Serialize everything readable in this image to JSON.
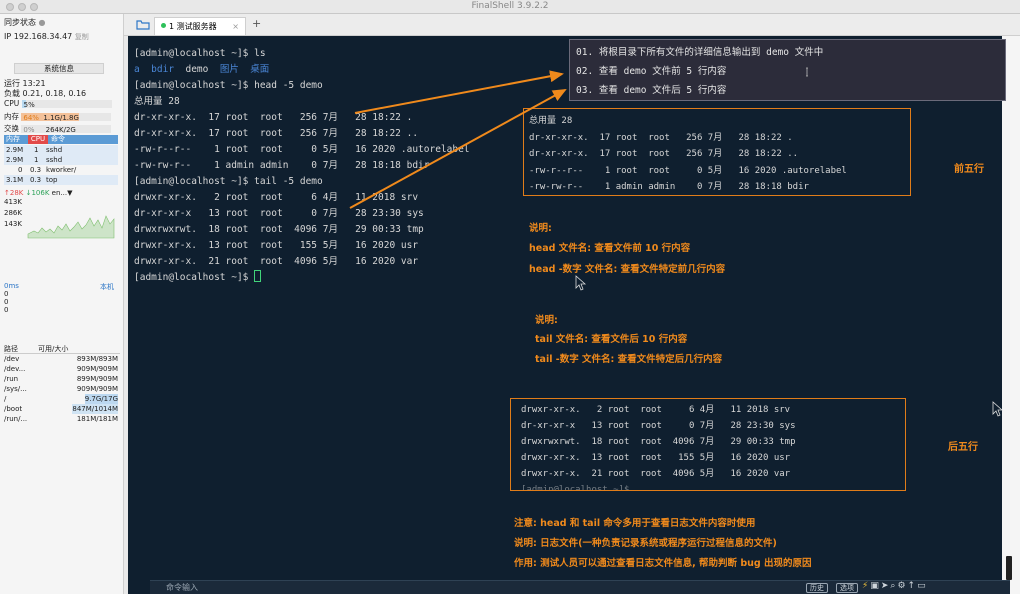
{
  "app": {
    "title": "FinalShell 3.9.2.2"
  },
  "sidebar": {
    "sync_status": "同步状态",
    "ip": "IP 192.168.34.47",
    "copy_label": "复制",
    "sysinfo_button": "系统信息",
    "uptime": "运行 13:21",
    "load": "负载 0.21, 0.18, 0.16",
    "cpu": {
      "label": "CPU",
      "value": "5%",
      "percent": 5
    },
    "mem": {
      "label": "内存",
      "pct": "64%",
      "value": "1.1G/1.8G",
      "percent": 64
    },
    "swap": {
      "label": "交换",
      "pct": "0%",
      "value": "264K/2G",
      "percent": 0
    },
    "proc_headers": [
      "内存",
      "CPU",
      "命令"
    ],
    "processes": [
      {
        "mem": "2.9M",
        "cpu": "1",
        "cmd": "sshd"
      },
      {
        "mem": "2.9M",
        "cpu": "1",
        "cmd": "sshd"
      },
      {
        "mem": "0",
        "cpu": "0.3",
        "cmd": "kworker/"
      },
      {
        "mem": "3.1M",
        "cpu": "0.3",
        "cmd": "top"
      }
    ],
    "net": {
      "up": "↑28K",
      "down": "↓106K",
      "iface": "en...",
      "ticks": [
        "413K",
        "286K",
        "143K"
      ]
    },
    "latency": {
      "value": "0ms",
      "host": "本机",
      "rows": [
        "0",
        "0",
        "0"
      ]
    },
    "disk_headers": [
      "路径",
      "可用/大小"
    ],
    "disks": [
      {
        "path": "/dev",
        "size": "893M/893M"
      },
      {
        "path": "/dev...",
        "size": "909M/909M"
      },
      {
        "path": "/run",
        "size": "899M/909M"
      },
      {
        "path": "/sys/...",
        "size": "909M/909M"
      },
      {
        "path": "/",
        "size": "9.7G/17G"
      },
      {
        "path": "/boot",
        "size": "847M/1014M"
      },
      {
        "path": "/run/...",
        "size": "181M/181M"
      }
    ]
  },
  "tabs": [
    {
      "label": "1 测试服务器"
    }
  ],
  "terminal": {
    "l01": "[admin@localhost ~]$ ls",
    "l02_a": "a  bdir",
    "l02_b": "  demo  ",
    "l02_c": "图片  桌面",
    "l03": "[admin@localhost ~]$ head -5 demo",
    "l04": "总用量 28",
    "l05": "dr-xr-xr-x.  17 root  root   256 7月   28 18:22 .",
    "l06": "dr-xr-xr-x.  17 root  root   256 7月   28 18:22 ..",
    "l07": "-rw-r--r--    1 root  root     0 5月   16 2020 .autorelabel",
    "l08": "-rw-rw-r--    1 admin admin    0 7月   28 18:18 bdir",
    "l09": "[admin@localhost ~]$ tail -5 demo",
    "l10": "drwxr-xr-x.   2 root  root     6 4月   11 2018 srv",
    "l11": "dr-xr-xr-x   13 root  root     0 7月   28 23:30 sys",
    "l12": "drwxrwxrwt.  18 root  root  4096 7月   29 00:33 tmp",
    "l13": "drwxr-xr-x.  13 root  root   155 5月   16 2020 usr",
    "l14": "drwxr-xr-x.  21 root  root  4096 5月   16 2020 var",
    "l15": "[admin@localhost ~]$ "
  },
  "notes": {
    "n1": "01. 将根目录下所有文件的详细信息输出到 demo 文件中",
    "n2": "02. 查看 demo 文件前 5 行内容",
    "n3": "03. 查看 demo 文件后 5 行内容"
  },
  "head_box": {
    "h1": "总用量 28",
    "h2": "dr-xr-xr-x.  17 root  root   256 7月   28 18:22 .",
    "h3": "dr-xr-xr-x.  17 root  root   256 7月   28 18:22 ..",
    "h4": "-rw-r--r--    1 root  root     0 5月   16 2020 .autorelabel",
    "h5": "-rw-rw-r--    1 admin admin    0 7月   28 18:18 bdir"
  },
  "tail_box": {
    "t1": "drwxr-xr-x.   2 root  root     6 4月   11 2018 srv",
    "t2": "dr-xr-xr-x   13 root  root     0 7月   28 23:30 sys",
    "t3": "drwxrwxrwt.  18 root  root  4096 7月   29 00:33 tmp",
    "t4": "drwxr-xr-x.  13 root  root   155 5月   16 2020 usr",
    "t5": "drwxr-xr-x.  21 root  root  4096 5月   16 2020 var",
    "t6": "[admin@localhost ~]$"
  },
  "annotations": {
    "first_five": "前五行",
    "last_five": "后五行",
    "head_title": "说明:",
    "head_1": "head 文件名: 查看文件前 10 行内容",
    "head_2": "head -数字 文件名: 查看文件特定前几行内容",
    "tail_title": "说明:",
    "tail_1": "tail 文件名: 查看文件后 10 行内容",
    "tail_2": "tail -数字 文件名: 查看文件特定后几行内容",
    "note": "注意: head 和 tail 命令多用于查看日志文件内容时使用",
    "explain": "说明: 日志文件(一种负责记录系统或程序运行过程信息的文件)",
    "purpose": "作用: 测试人员可以通过查看日志文件信息, 帮助判断 bug 出现的原因"
  },
  "bottom": {
    "command_input": "命令输入",
    "history": "历史",
    "options": "选项"
  },
  "colors": {
    "accent": "#f08a1c",
    "terminal_bg": "#0f1f2f",
    "tab_active": "#2ec05a"
  }
}
